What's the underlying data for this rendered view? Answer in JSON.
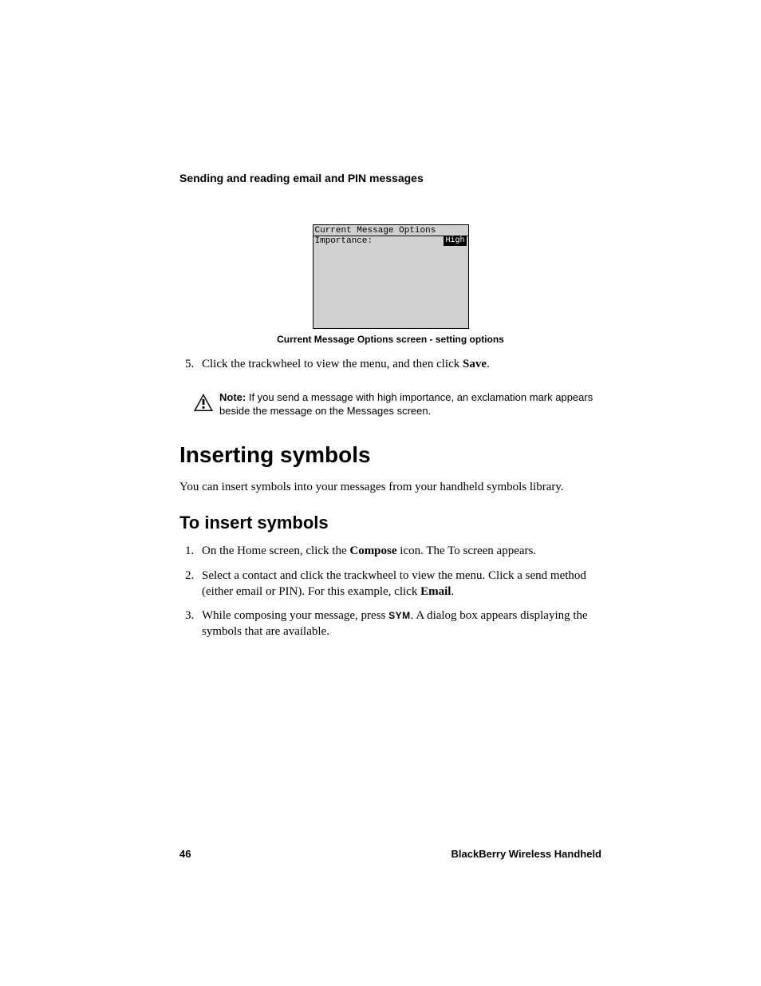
{
  "header": {
    "section_title": "Sending and reading email and PIN messages"
  },
  "figure": {
    "screen_title": "Current Message Options",
    "field_label": "Importance:",
    "field_value": "High",
    "caption": "Current Message Options screen - setting options"
  },
  "step5": {
    "number": "5.",
    "pre": "Click the trackwheel to view the menu, and then click ",
    "bold": "Save",
    "post": "."
  },
  "note": {
    "label": "Note:",
    "text": " If you send a message with high importance, an exclamation mark appears beside the message on the Messages screen."
  },
  "h1": "Inserting symbols",
  "intro": "You can insert symbols into your messages from your handheld symbols library.",
  "h2": "To insert symbols",
  "steps": {
    "s1_pre": "On the Home screen, click the ",
    "s1_bold": "Compose",
    "s1_post": " icon. The To screen appears.",
    "s2_pre": "Select a contact and click the trackwheel to view the menu. Click a send method (either email or PIN). For this example, click ",
    "s2_bold": "Email",
    "s2_post": ".",
    "s3_pre": "While composing your message, press ",
    "s3_sym": "SYM",
    "s3_post": ". A dialog box appears displaying the symbols that are available."
  },
  "footer": {
    "page_number": "46",
    "product": "BlackBerry Wireless Handheld"
  }
}
